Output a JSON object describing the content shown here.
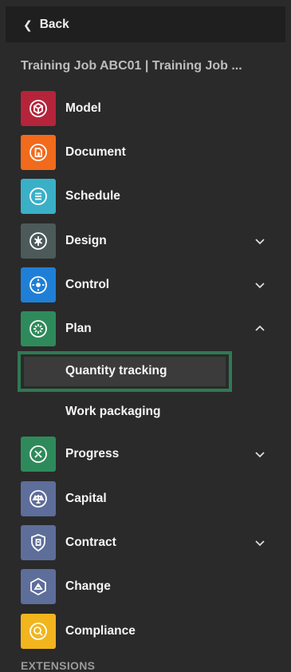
{
  "back": {
    "label": "Back"
  },
  "job_title": "Training Job ABC01 | Training Job ...",
  "nav": {
    "model": {
      "label": "Model",
      "color": "#b5243a",
      "icon": "cube-icon"
    },
    "document": {
      "label": "Document",
      "color": "#f26a1b",
      "icon": "document-icon"
    },
    "schedule": {
      "label": "Schedule",
      "color": "#3ab0c8",
      "icon": "schedule-icon"
    },
    "design": {
      "label": "Design",
      "color": "#4c5a5a",
      "icon": "design-icon",
      "expanded": false
    },
    "control": {
      "label": "Control",
      "color": "#1f7fd6",
      "icon": "control-icon",
      "expanded": false
    },
    "plan": {
      "label": "Plan",
      "color": "#2f8a5b",
      "icon": "plan-icon",
      "expanded": true
    },
    "quantity": {
      "label": "Quantity tracking",
      "selected": true
    },
    "workpack": {
      "label": "Work packaging"
    },
    "progress": {
      "label": "Progress",
      "color": "#2f8a5b",
      "icon": "progress-icon",
      "expanded": false
    },
    "capital": {
      "label": "Capital",
      "color": "#5e6e9a",
      "icon": "scale-icon"
    },
    "contract": {
      "label": "Contract",
      "color": "#5e6e9a",
      "icon": "contract-icon",
      "expanded": false
    },
    "change": {
      "label": "Change",
      "color": "#5e6e9a",
      "icon": "change-icon"
    },
    "compliance": {
      "label": "Compliance",
      "color": "#f2b51d",
      "icon": "compliance-icon"
    }
  },
  "section_extensions": "EXTENSIONS",
  "colors": {
    "background": "#2a2a2a",
    "topbar": "#1f1f1f",
    "selected_outline": "#2e7a53",
    "selected_bg": "#3b3b3b"
  }
}
